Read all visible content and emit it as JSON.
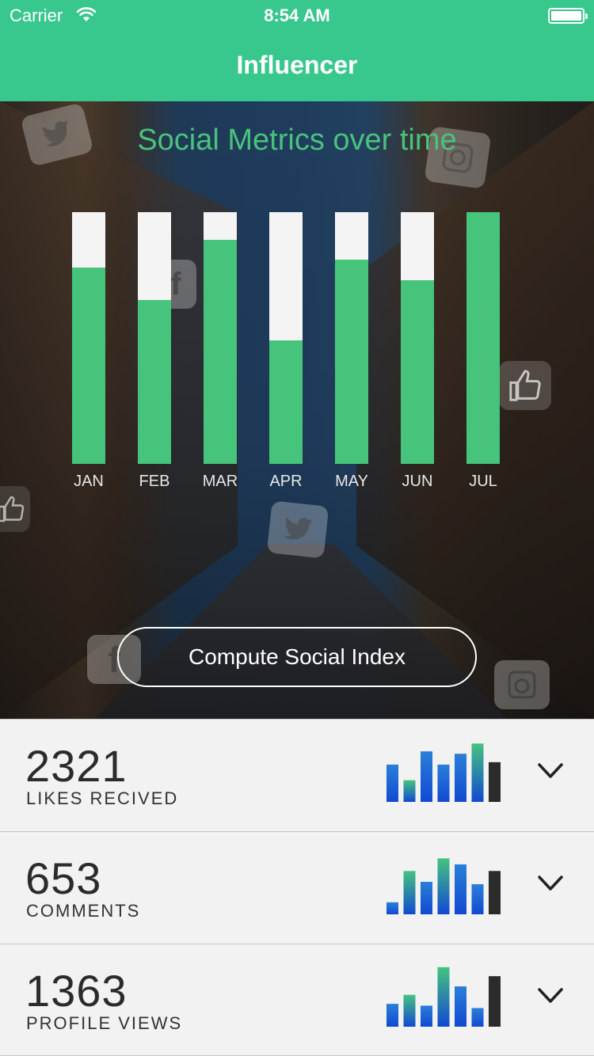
{
  "status_bar": {
    "carrier": "Carrier",
    "time": "8:54 AM"
  },
  "app": {
    "title": "Influencer"
  },
  "hero": {
    "chart_title": "Social Metrics over time",
    "button_label": "Compute Social Index"
  },
  "chart_data": {
    "type": "bar",
    "title": "Social Metrics over time",
    "categories": [
      "JAN",
      "FEB",
      "MAR",
      "APR",
      "MAY",
      "JUN",
      "JUL"
    ],
    "values": [
      0.78,
      0.65,
      0.89,
      0.49,
      0.81,
      0.73,
      1.0
    ],
    "ylim": [
      0,
      1
    ],
    "colors": {
      "fill": "#47c47b",
      "track": "#f4f4f4"
    }
  },
  "stats": [
    {
      "value": "2321",
      "label": "LIKES RECIVED",
      "spark": [
        0.62,
        0.36,
        0.84,
        0.62,
        0.8,
        0.97,
        0.66
      ]
    },
    {
      "value": "653",
      "label": "COMMENTS",
      "spark": [
        0.2,
        0.72,
        0.54,
        0.93,
        0.83,
        0.5,
        0.72
      ]
    },
    {
      "value": "1363",
      "label": "PROFILE VIEWS",
      "spark": [
        0.38,
        0.53,
        0.35,
        0.99,
        0.67,
        0.31,
        0.84
      ]
    }
  ],
  "icons": {
    "wifi": "wifi-icon",
    "battery": "battery-icon",
    "chevron": "chevron-down-icon",
    "sparkline": "bar-chart-icon"
  },
  "colors": {
    "brand": "#38c78d",
    "chart_green": "#47c47b",
    "spark_blue_top": "#2a7fd8",
    "spark_blue_bottom": "#1149d2",
    "spark_green": "#45c37f",
    "spark_dark": "#2b2b2b"
  }
}
